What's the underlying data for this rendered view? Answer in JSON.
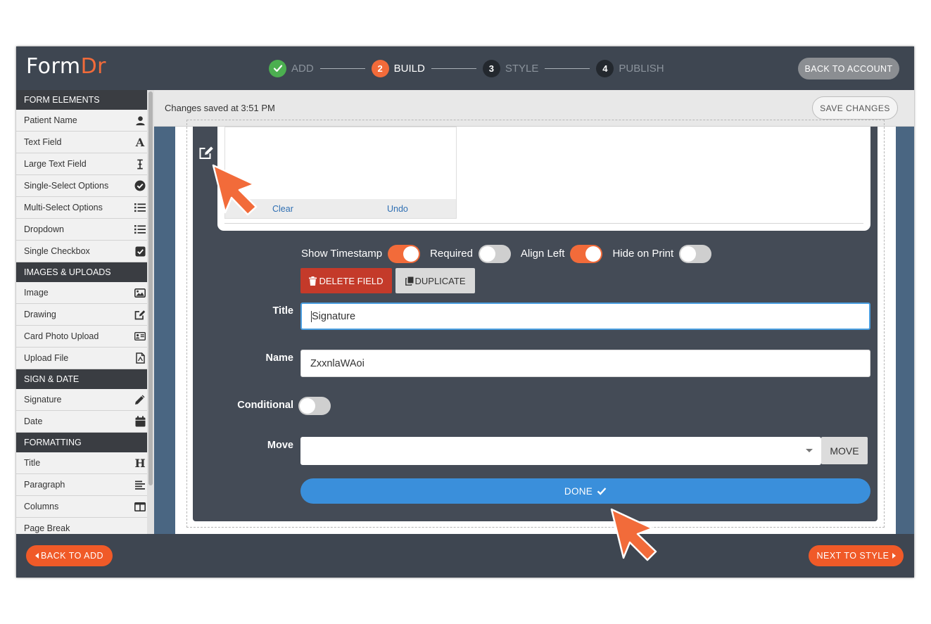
{
  "app": {
    "logo_main": "Form",
    "logo_accent": "Dr",
    "steps": [
      {
        "num": "✓",
        "label": "ADD"
      },
      {
        "num": "2",
        "label": "BUILD"
      },
      {
        "num": "3",
        "label": "STYLE"
      },
      {
        "num": "4",
        "label": "PUBLISH"
      }
    ],
    "back_to_account": "BACK TO ACCOUNT"
  },
  "sidebar": {
    "sections": [
      {
        "title": "FORM ELEMENTS",
        "items": [
          {
            "label": "Patient Name",
            "icon": "user-icon"
          },
          {
            "label": "Text Field",
            "icon": "text-icon"
          },
          {
            "label": "Large Text Field",
            "icon": "text-cursor-icon"
          },
          {
            "label": "Single-Select Options",
            "icon": "check-circle-icon"
          },
          {
            "label": "Multi-Select Options",
            "icon": "list-icon"
          },
          {
            "label": "Dropdown",
            "icon": "list-icon"
          },
          {
            "label": "Single Checkbox",
            "icon": "checkbox-icon"
          }
        ]
      },
      {
        "title": "IMAGES & UPLOADS",
        "items": [
          {
            "label": "Image",
            "icon": "image-icon"
          },
          {
            "label": "Drawing",
            "icon": "edit-icon"
          },
          {
            "label": "Card Photo Upload",
            "icon": "id-card-icon"
          },
          {
            "label": "Upload File",
            "icon": "file-icon"
          }
        ]
      },
      {
        "title": "SIGN & DATE",
        "items": [
          {
            "label": "Signature",
            "icon": "pencil-icon"
          },
          {
            "label": "Date",
            "icon": "calendar-icon"
          }
        ]
      },
      {
        "title": "FORMATTING",
        "items": [
          {
            "label": "Title",
            "icon": "heading-icon"
          },
          {
            "label": "Paragraph",
            "icon": "align-left-icon"
          },
          {
            "label": "Columns",
            "icon": "columns-icon"
          },
          {
            "label": "Page Break",
            "icon": "page-break-icon"
          }
        ]
      }
    ]
  },
  "savebar": {
    "message": "Changes saved at 3:51 PM",
    "save_button": "SAVE CHANGES"
  },
  "signature": {
    "clear": "Clear",
    "undo": "Undo"
  },
  "field_options": {
    "toggles": [
      {
        "label": "Show Timestamp",
        "on": true
      },
      {
        "label": "Required",
        "on": false
      },
      {
        "label": "Align Left",
        "on": true
      },
      {
        "label": "Hide on Print",
        "on": false
      }
    ],
    "delete_button": "DELETE FIELD",
    "duplicate_button": "DUPLICATE",
    "title_label": "Title",
    "title_value": "Signature",
    "name_label": "Name",
    "name_value": "ZxxnlaWAoi",
    "conditional_label": "Conditional",
    "conditional_on": false,
    "move_label": "Move",
    "move_value": "",
    "move_button": "MOVE",
    "done_button": "DONE"
  },
  "footer": {
    "back_button": "BACK TO ADD",
    "next_button": "NEXT TO STYLE"
  },
  "colors": {
    "brand_orange": "#f26b3a",
    "header_bg": "#3e4651",
    "done_blue": "#3a8fdb",
    "delete_red": "#c43a2a",
    "success_green": "#4caf50"
  }
}
